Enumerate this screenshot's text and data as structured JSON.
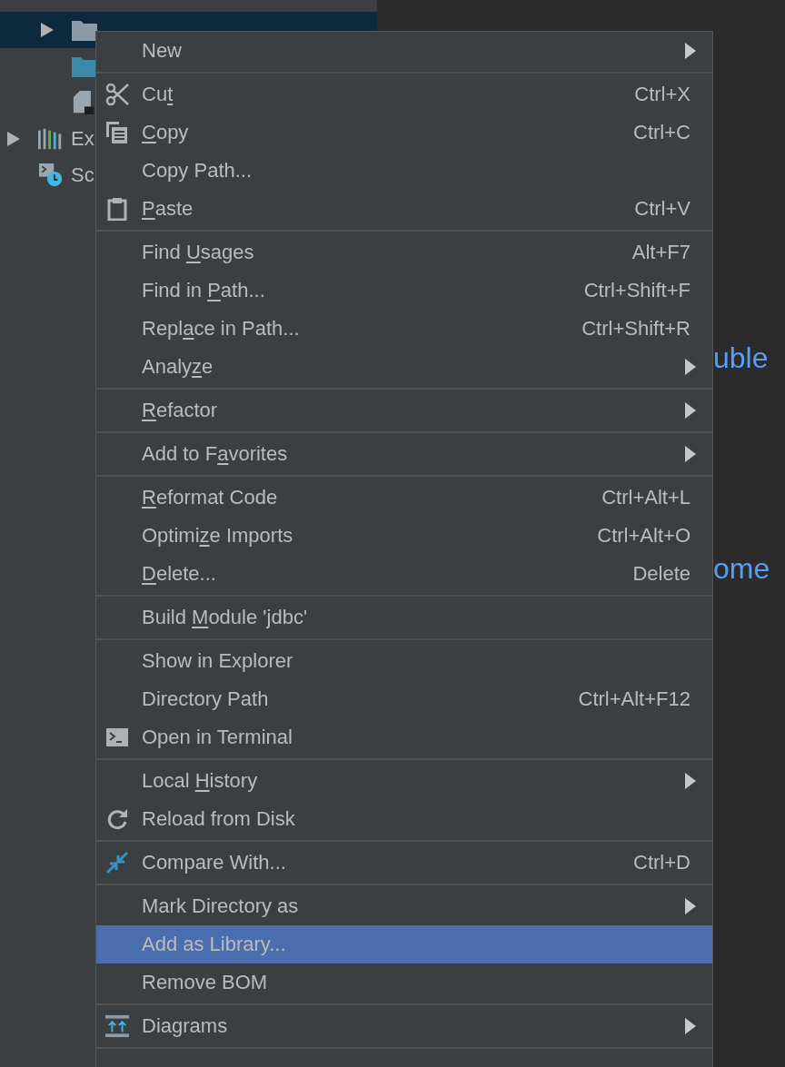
{
  "project_tree": {
    "module_items": [
      {
        "kind": "node",
        "selected": true
      },
      {
        "kind": "leaf",
        "selected": false
      },
      {
        "kind": "leaf",
        "selected": false
      }
    ],
    "root_items": [
      {
        "kind": "node",
        "label": "Ex",
        "selected": false
      },
      {
        "kind": "leaf",
        "label": "Sc",
        "selected": false
      }
    ]
  },
  "editor": {
    "lines": [
      "uble",
      "ome"
    ]
  },
  "context_menu": {
    "groups": [
      [
        {
          "label": "New",
          "submenu": true,
          "selected": false
        }
      ],
      [
        {
          "parts": {
            "before": "Cu",
            "key": "t"
          },
          "shortcut": "Ctrl+X",
          "submenu": false,
          "selected": false
        },
        {
          "parts": {
            "key": "C",
            "after": "opy"
          },
          "shortcut": "Ctrl+C",
          "submenu": false,
          "selected": false
        },
        {
          "label": "Copy Path...",
          "submenu": false,
          "selected": false
        },
        {
          "parts": {
            "key": "P",
            "after": "aste"
          },
          "shortcut": "Ctrl+V",
          "submenu": false,
          "selected": false
        }
      ],
      [
        {
          "parts": {
            "before": "Find ",
            "key": "U",
            "after": "sages"
          },
          "shortcut": "Alt+F7",
          "submenu": false,
          "selected": false
        },
        {
          "parts": {
            "before": "Find in ",
            "key": "P",
            "after": "ath..."
          },
          "shortcut": "Ctrl+Shift+F",
          "submenu": false,
          "selected": false
        },
        {
          "parts": {
            "before": "Repl",
            "key": "a",
            "after": "ce in Path..."
          },
          "shortcut": "Ctrl+Shift+R",
          "submenu": false,
          "selected": false
        },
        {
          "parts": {
            "before": "Analy",
            "key": "z",
            "after": "e"
          },
          "submenu": true,
          "selected": false
        }
      ],
      [
        {
          "parts": {
            "key": "R",
            "after": "efactor"
          },
          "submenu": true,
          "selected": false
        }
      ],
      [
        {
          "parts": {
            "before": "Add to F",
            "key": "a",
            "after": "vorites"
          },
          "submenu": true,
          "selected": false
        }
      ],
      [
        {
          "parts": {
            "key": "R",
            "after": "eformat Code"
          },
          "shortcut": "Ctrl+Alt+L",
          "submenu": false,
          "selected": false
        },
        {
          "parts": {
            "before": "Optimi",
            "key": "z",
            "after": "e Imports"
          },
          "shortcut": "Ctrl+Alt+O",
          "submenu": false,
          "selected": false
        },
        {
          "parts": {
            "key": "D",
            "after": "elete..."
          },
          "shortcut": "Delete",
          "submenu": false,
          "selected": false
        }
      ],
      [
        {
          "parts": {
            "before": "Build ",
            "key": "M",
            "after": "odule 'jdbc'"
          },
          "submenu": false,
          "selected": false
        }
      ],
      [
        {
          "label": "Show in Explorer",
          "submenu": false,
          "selected": false
        },
        {
          "label": "Directory Path",
          "shortcut": "Ctrl+Alt+F12",
          "submenu": false,
          "selected": false
        },
        {
          "label": "Open in Terminal",
          "submenu": false,
          "selected": false
        }
      ],
      [
        {
          "parts": {
            "before": "Local ",
            "key": "H",
            "after": "istory"
          },
          "submenu": true,
          "selected": false
        },
        {
          "label": "Reload from Disk",
          "submenu": false,
          "selected": false
        }
      ],
      [
        {
          "label": "Compare With...",
          "shortcut": "Ctrl+D",
          "submenu": false,
          "selected": false
        }
      ],
      [
        {
          "label": "Mark Directory as",
          "submenu": true,
          "selected": false
        },
        {
          "label": "Add as Library...",
          "submenu": false,
          "selected": true
        },
        {
          "label": "Remove BOM",
          "submenu": false,
          "selected": false
        }
      ],
      [
        {
          "label": "Diagrams",
          "submenu": true,
          "selected": false
        }
      ]
    ]
  }
}
